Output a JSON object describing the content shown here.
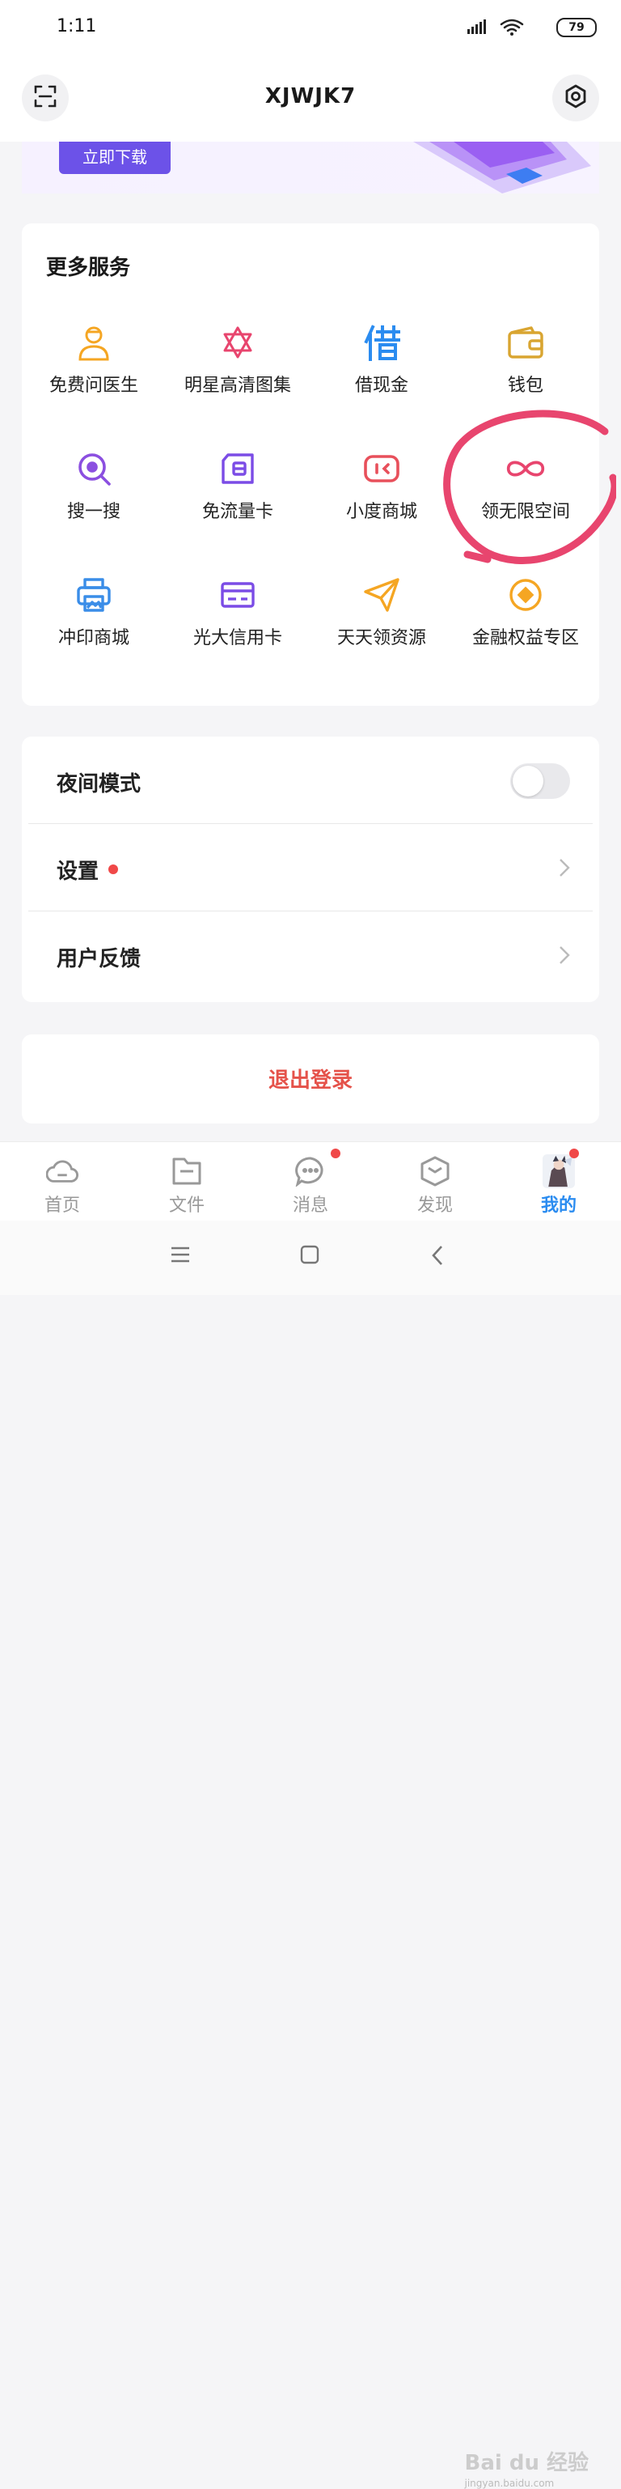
{
  "status_bar": {
    "time": "1:11",
    "battery": "79"
  },
  "header": {
    "title": "XJWJK7",
    "scan_icon": "scan-icon",
    "settings_icon": "settings-icon"
  },
  "banner": {
    "download_label": "立即下载"
  },
  "services": {
    "title": "更多服务",
    "items": [
      {
        "label": "免费问医生",
        "icon": "doctor-icon",
        "color": "#f5a623"
      },
      {
        "label": "明星高清图集",
        "icon": "star-hexagram-icon",
        "color": "#e8456e"
      },
      {
        "label": "借现金",
        "icon": "borrow-char-icon",
        "color": "#2b8cf0"
      },
      {
        "label": "钱包",
        "icon": "wallet-icon",
        "color": "#d9a531"
      },
      {
        "label": "搜一搜",
        "icon": "search-icon",
        "color": "#8b4fe0"
      },
      {
        "label": "免流量卡",
        "icon": "sim-card-icon",
        "color": "#7b4ce6"
      },
      {
        "label": "小度商城",
        "icon": "xiaodu-shop-icon",
        "color": "#e8505b"
      },
      {
        "label": "领无限空间",
        "icon": "infinity-icon",
        "color": "#e8456e"
      },
      {
        "label": "冲印商城",
        "icon": "printer-icon",
        "color": "#3a8de8"
      },
      {
        "label": "光大信用卡",
        "icon": "credit-card-icon",
        "color": "#7b4ce6"
      },
      {
        "label": "天天领资源",
        "icon": "paper-plane-icon",
        "color": "#f5a623"
      },
      {
        "label": "金融权益专区",
        "icon": "finance-coin-icon",
        "color": "#f5a623"
      }
    ]
  },
  "settings": {
    "night_mode": {
      "label": "夜间模式",
      "enabled": false
    },
    "settings_label": "设置",
    "feedback_label": "用户反馈"
  },
  "logout": {
    "label": "退出登录"
  },
  "tabs": [
    {
      "label": "首页",
      "icon": "cloud-icon",
      "active": false,
      "badge": false
    },
    {
      "label": "文件",
      "icon": "folder-icon",
      "active": false,
      "badge": false
    },
    {
      "label": "消息",
      "icon": "chat-icon",
      "active": false,
      "badge": true
    },
    {
      "label": "发现",
      "icon": "discover-icon",
      "active": false,
      "badge": false
    },
    {
      "label": "我的",
      "icon": "avatar",
      "active": true,
      "badge": true
    }
  ],
  "watermark": {
    "text": "Bai du 经验",
    "sub": "jingyan.baidu.com"
  },
  "colors": {
    "accent": "#2b8cf0",
    "logout": "#e5524a",
    "banner_button": "#6c52e8",
    "annotation": "#e8456e"
  }
}
